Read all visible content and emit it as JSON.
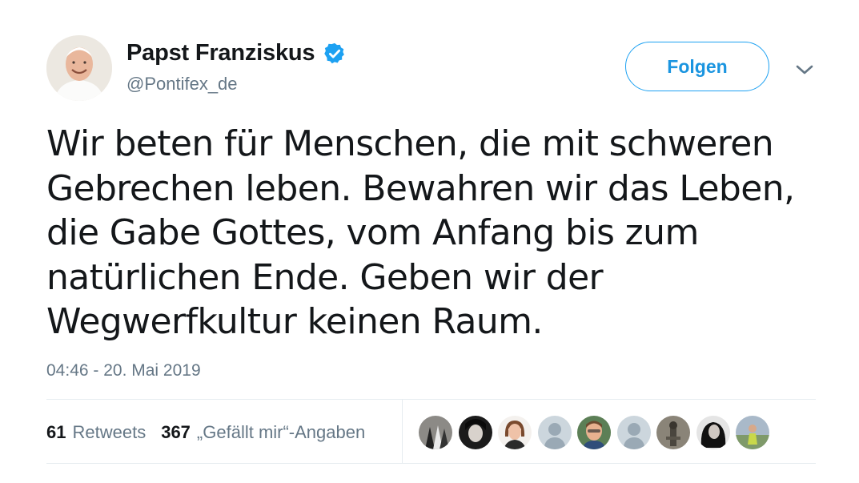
{
  "user": {
    "name": "Papst Franziskus",
    "handle": "@Pontifex_de",
    "verified": true
  },
  "actions": {
    "follow_label": "Folgen"
  },
  "tweet": {
    "lines": [
      "Wir beten für Menschen, die mit schweren",
      "Gebrechen leben. Bewahren wir das Leben,",
      "die Gabe Gottes, vom Anfang bis zum",
      "natürlichen Ende. Geben wir der",
      "Wegwerfkultur keinen Raum."
    ],
    "timestamp": "04:46 - 20. Mai 2019"
  },
  "stats": {
    "retweets_count": "61",
    "retweets_label": "Retweets",
    "likes_count": "367",
    "likes_label": "„Gefällt mir“-Angaben"
  },
  "colors": {
    "accent": "#1da1f2",
    "follow_text": "#1b95e0",
    "secondary_text": "#657786",
    "primary_text": "#14171a",
    "divider": "#e6ecf0"
  },
  "icons": {
    "verified": "verified-badge-icon",
    "caret": "chevron-down-icon"
  }
}
